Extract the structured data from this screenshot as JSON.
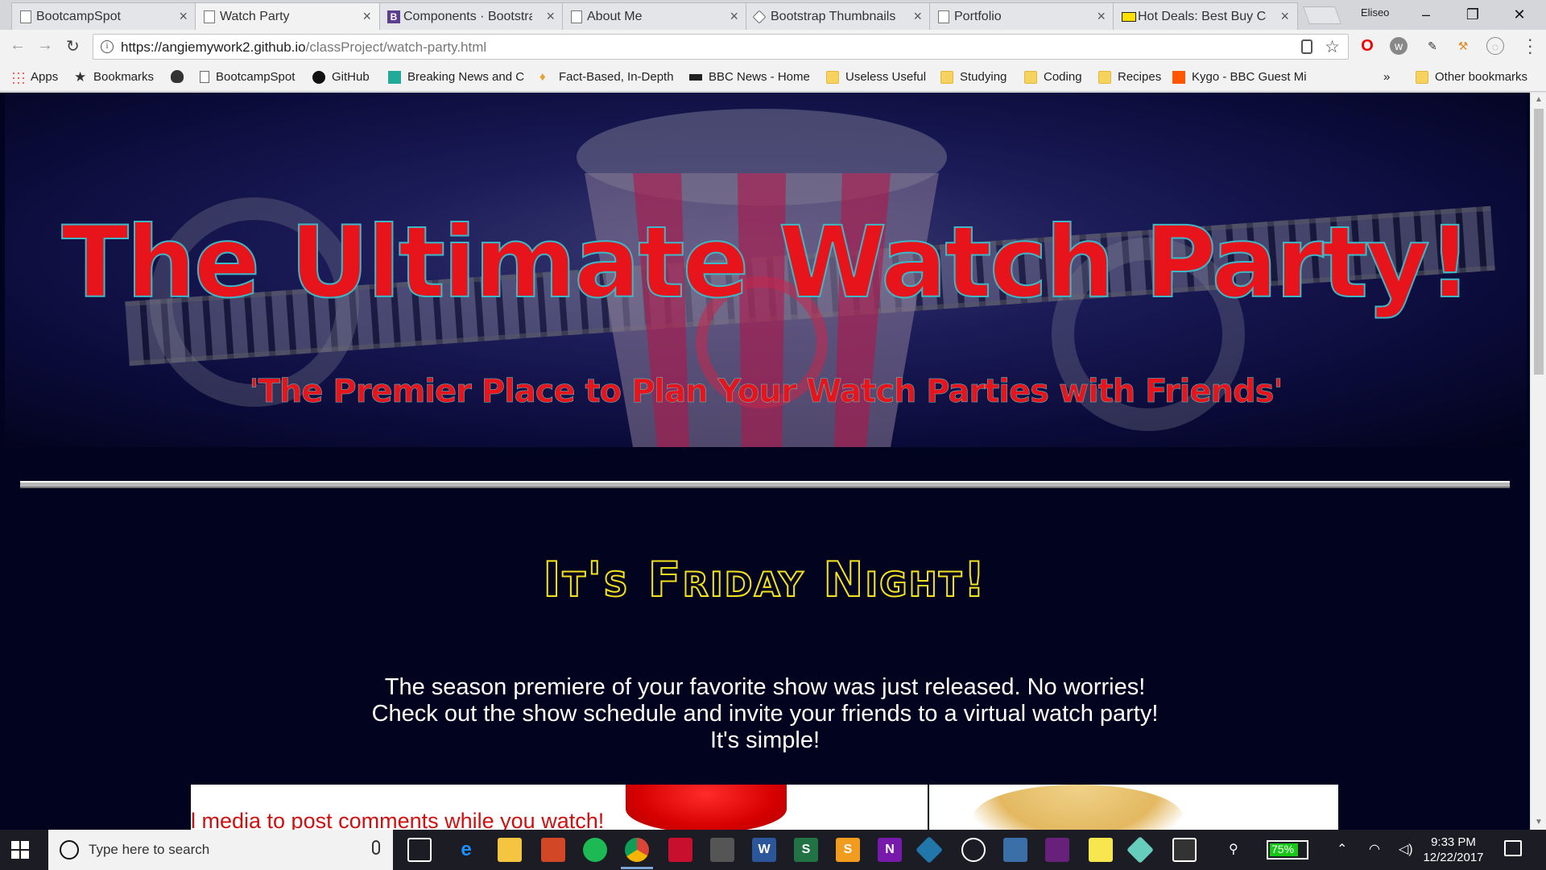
{
  "browser": {
    "tabs": [
      {
        "title": "BootcampSpot",
        "icon": "page-icon",
        "active": false
      },
      {
        "title": "Watch Party",
        "icon": "page-icon",
        "active": true
      },
      {
        "title": "Components · Bootstra",
        "icon": "bootstrap-icon",
        "active": false
      },
      {
        "title": "About Me",
        "icon": "page-icon",
        "active": false
      },
      {
        "title": "Bootstrap Thumbnails",
        "icon": "diamond-icon",
        "active": false
      },
      {
        "title": "Portfolio",
        "icon": "page-icon",
        "active": false
      },
      {
        "title": "Hot Deals: Best Buy Co",
        "icon": "bestbuy-icon",
        "active": false
      }
    ],
    "profile_name": "Eliseo",
    "url_host": "https://angiemywork2.github.io",
    "url_path": "/classProject/watch-party.html",
    "bookmarks": [
      {
        "label": "Apps",
        "icon": "apps-grid-icon"
      },
      {
        "label": "Bookmarks",
        "icon": "star-icon"
      },
      {
        "label": "",
        "icon": "bug-icon"
      },
      {
        "label": "BootcampSpot",
        "icon": "page-icon"
      },
      {
        "label": "GitHub",
        "icon": "github-icon"
      },
      {
        "label": "Breaking News and C",
        "icon": "news-icon"
      },
      {
        "label": "Fact-Based, In-Depth",
        "icon": "flame-icon"
      },
      {
        "label": "BBC News - Home",
        "icon": "bbc-icon"
      },
      {
        "label": "Useless Useful",
        "icon": "folder-icon"
      },
      {
        "label": "Studying",
        "icon": "folder-icon"
      },
      {
        "label": "Coding",
        "icon": "folder-icon"
      },
      {
        "label": "Recipes",
        "icon": "folder-icon"
      },
      {
        "label": "Kygo - BBC Guest Mi",
        "icon": "soundcloud-icon"
      }
    ],
    "overflow_chevron": "»",
    "other_bookmarks": "Other bookmarks"
  },
  "page": {
    "hero_title": "The Ultimate Watch Party!",
    "hero_subtitle": "'The Premier Place to Plan Your Watch Parties with Friends'",
    "section_heading": "It's Friday Night!",
    "intro_lines": [
      "The season premiere of your favorite show was just released. No worries!",
      "Check out the show schedule and invite your friends to a virtual watch party!",
      "It's simple!"
    ],
    "card_caption": "l media to post comments while you watch!"
  },
  "taskbar": {
    "search_placeholder": "Type here to search",
    "battery": "75%",
    "time": "9:33 PM",
    "date": "12/22/2017"
  },
  "colors": {
    "page_bg": "#02031f",
    "hero_text": "#e8141c",
    "hero_outline": "#3fb7c7",
    "friday_outline": "#f2e21f",
    "battery_fill": "#18c618"
  }
}
